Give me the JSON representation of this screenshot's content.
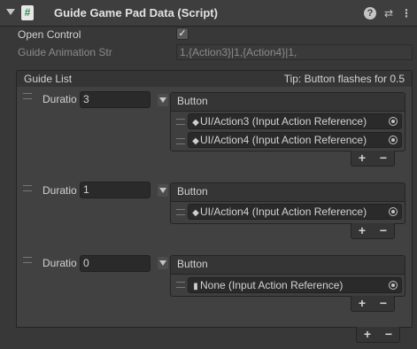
{
  "header": {
    "title": "Guide Game Pad Data (Script)",
    "script_icon": "#"
  },
  "fields": {
    "open_control_label": "Open Control",
    "open_control_checked": "✓",
    "guide_anim_label": "Guide Animation Str",
    "guide_anim_value": "1,{Action3}|1,{Action4}|1,"
  },
  "guide_list": {
    "label": "Guide List",
    "tip": "Tip: Button flashes for 0.5",
    "items": [
      {
        "duration_label": "Duratio",
        "duration": "3",
        "button_label": "Button",
        "actions": [
          "UI/Action3 (Input Action Reference)",
          "UI/Action4 (Input Action Reference)"
        ]
      },
      {
        "duration_label": "Duratio",
        "duration": "1",
        "button_label": "Button",
        "actions": [
          "UI/Action4 (Input Action Reference)"
        ]
      },
      {
        "duration_label": "Duratio",
        "duration": "0",
        "button_label": "Button",
        "actions": [
          "None (Input Action Reference)"
        ]
      }
    ]
  },
  "controls": {
    "add": "+",
    "remove": "−"
  }
}
